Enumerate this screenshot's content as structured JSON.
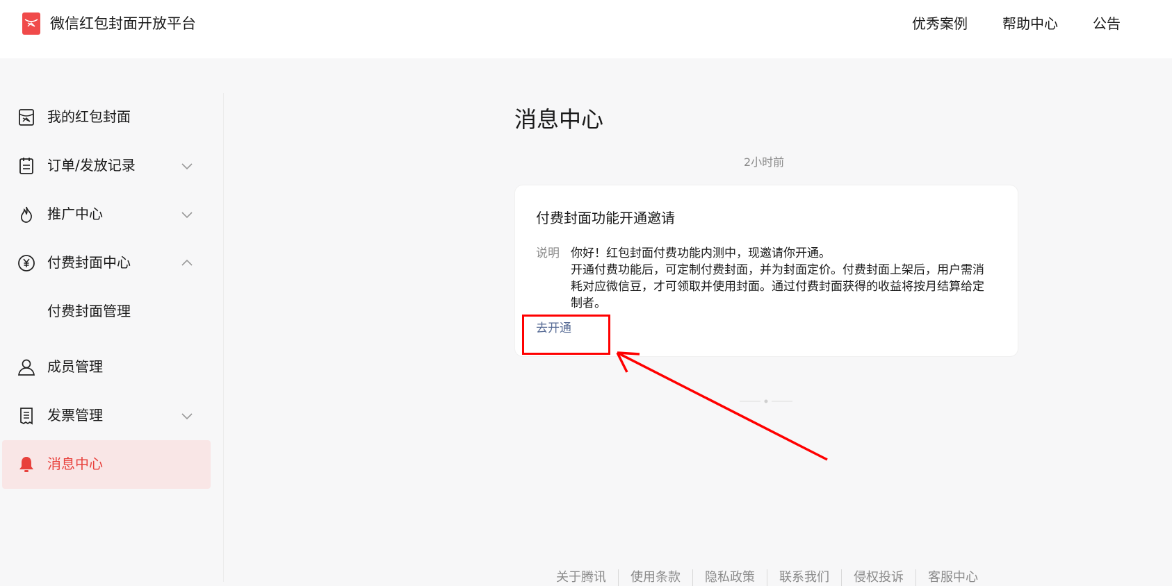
{
  "header": {
    "brand": "微信红包封面开放平台",
    "nav": [
      "优秀案例",
      "帮助中心",
      "公告"
    ]
  },
  "sidebar": {
    "items": [
      {
        "label": "我的红包封面",
        "icon": "red-envelope-icon"
      },
      {
        "label": "订单/发放记录",
        "icon": "order-list-icon"
      },
      {
        "label": "推广中心",
        "icon": "flame-icon"
      },
      {
        "label": "付费封面中心",
        "icon": "yen-icon"
      },
      {
        "label": "付费封面管理"
      },
      {
        "label": "成员管理",
        "icon": "member-icon"
      },
      {
        "label": "发票管理",
        "icon": "invoice-icon"
      },
      {
        "label": "消息中心",
        "icon": "bell-icon"
      }
    ]
  },
  "main": {
    "title": "消息中心",
    "timestamp": "2小时前",
    "card": {
      "title": "付费封面功能开通邀请",
      "desc_label": "说明",
      "desc_lines": [
        "你好！红包封面付费功能内测中，现邀请你开通。",
        "开通付费功能后，可定制付费封面，并为封面定价。付费封面上架后，用户需消",
        "耗对应微信豆，才可领取并使用封面。通过付费封面获得的收益将按月结算给定",
        "制者。"
      ],
      "action": "去开通"
    }
  },
  "footer": {
    "links": [
      "关于腾讯",
      "使用条款",
      "隐私政策",
      "联系我们",
      "侵权投诉",
      "客服中心"
    ]
  },
  "colors": {
    "accent_red": "#e8413c",
    "link_blue": "#576b95",
    "annotation_red": "#ff0000"
  }
}
